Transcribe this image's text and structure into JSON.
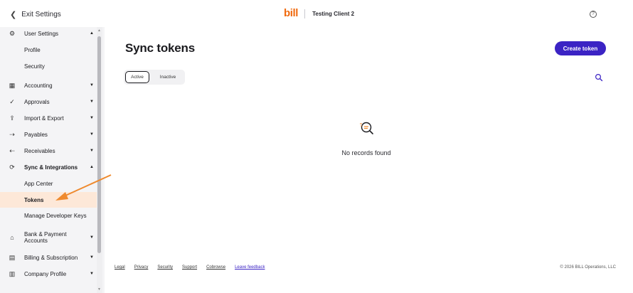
{
  "topbar": {
    "exit_label": "Exit Settings",
    "brand": "bill",
    "client": "Testing Client 2",
    "help_glyph": "?"
  },
  "sidebar": {
    "items": [
      {
        "label": "User Settings",
        "icon": "gear-icon",
        "glyph": "⚙",
        "caret": "▲"
      },
      {
        "label": "Profile"
      },
      {
        "label": "Security"
      },
      {
        "label": "Accounting",
        "icon": "table-icon",
        "glyph": "▦",
        "caret": "▼"
      },
      {
        "label": "Approvals",
        "icon": "check-circle-icon",
        "glyph": "✓",
        "caret": "▼"
      },
      {
        "label": "Import & Export",
        "icon": "upload-icon",
        "glyph": "⇪",
        "caret": "▼"
      },
      {
        "label": "Payables",
        "icon": "pay-arrow-icon",
        "glyph": "⇢",
        "caret": "▼"
      },
      {
        "label": "Receivables",
        "icon": "receive-arrow-icon",
        "glyph": "⇠",
        "caret": "▼"
      },
      {
        "label": "Sync & Integrations",
        "icon": "sync-icon",
        "glyph": "⟳",
        "caret": "▲"
      },
      {
        "label": "App Center"
      },
      {
        "label": "Tokens"
      },
      {
        "label": "Manage Developer Keys"
      },
      {
        "label": "Bank & Payment Accounts",
        "line1": "Bank & Payment",
        "line2": "Accounts",
        "icon": "bank-icon",
        "glyph": "⌂",
        "caret": "▼"
      },
      {
        "label": "Billing & Subscription",
        "icon": "billing-icon",
        "glyph": "▤",
        "caret": "▼"
      },
      {
        "label": "Company Profile",
        "icon": "building-icon",
        "glyph": "▥",
        "caret": "▼"
      }
    ]
  },
  "main": {
    "title": "Sync tokens",
    "create_button": "Create token",
    "tabs": [
      {
        "label": "Active"
      },
      {
        "label": "Inactive"
      }
    ],
    "empty_text": "No records found"
  },
  "footer": {
    "links": [
      "Legal",
      "Privacy",
      "Security",
      "Support",
      "Cobrowse",
      "Leave feedback"
    ],
    "copyright": "© 2026 BILL Operations, LLC"
  },
  "colors": {
    "brand": "#f06a0f",
    "primary": "#3b23c4",
    "active_item_bg": "#fde8d8",
    "annotation_arrow": "#ef8a2e"
  }
}
